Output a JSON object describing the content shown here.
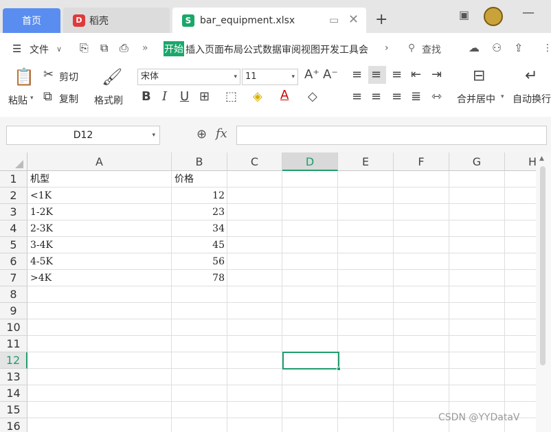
{
  "tabs": {
    "home": "首页",
    "daoke": "稻壳",
    "file": "bar_equipment.xlsx"
  },
  "menu": {
    "file_label": "文件",
    "ribbon_active": "开始",
    "ribbon_tabs": "插入页面布局公式数据审阅视图开发工具会",
    "search_label": "查找"
  },
  "toolbar": {
    "paste": "粘贴",
    "cut": "剪切",
    "copy": "复制",
    "format_painter": "格式刷",
    "font_name": "宋体",
    "font_size": "11",
    "merge_center": "合并居中",
    "wrap_text": "自动换行"
  },
  "formula_bar": {
    "name_box": "D12",
    "fx_label": "fx",
    "formula": ""
  },
  "grid": {
    "columns": [
      "A",
      "B",
      "C",
      "D",
      "E",
      "F",
      "G",
      "H"
    ],
    "rows": [
      "1",
      "2",
      "3",
      "4",
      "5",
      "6",
      "7",
      "8",
      "9",
      "10",
      "11",
      "12",
      "13",
      "14",
      "15",
      "16"
    ],
    "header_a": "机型",
    "header_b": "价格",
    "models": [
      "<1K",
      "1-2K",
      "2-3K",
      "3-4K",
      "4-5K",
      ">4K"
    ],
    "prices": [
      "12",
      "23",
      "34",
      "45",
      "56",
      "78"
    ],
    "selected_cell": "D12"
  },
  "watermark": "CSDN @YYDataV"
}
